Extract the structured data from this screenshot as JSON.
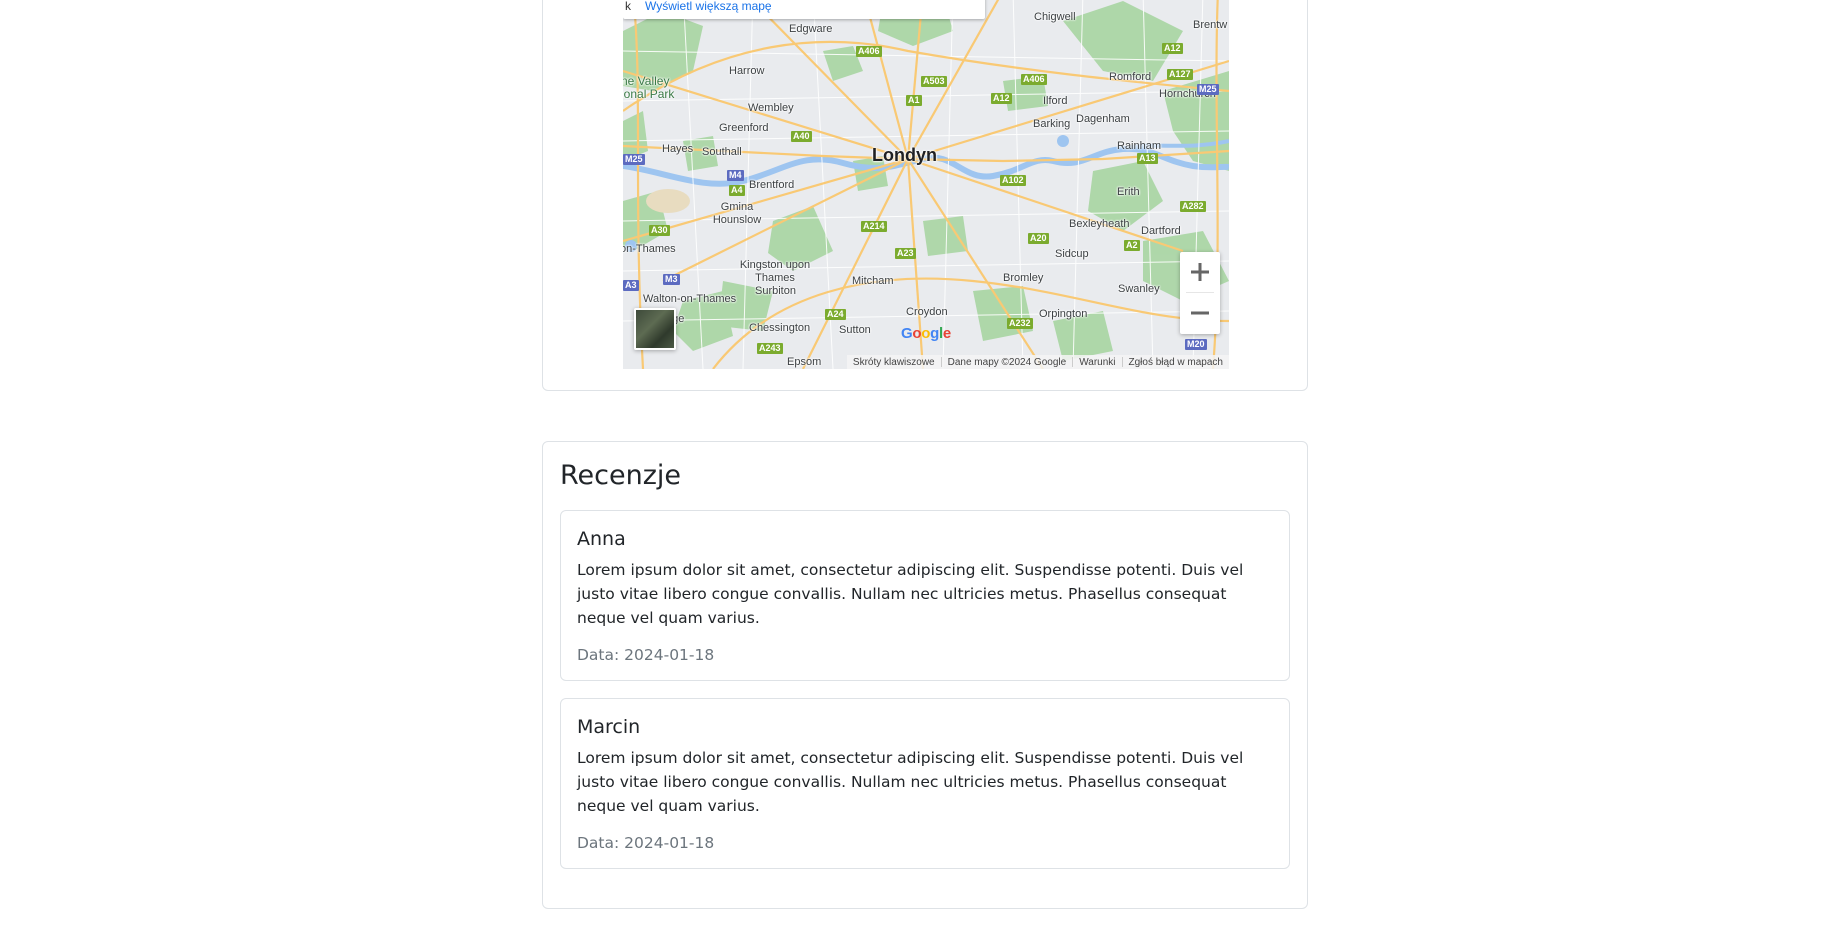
{
  "map": {
    "larger_map_link": "Wyświetl większą mapę",
    "city": "Londyn",
    "places": [
      "Chigwell",
      "Edgware",
      "Harrow",
      "Wembley",
      "Greenford",
      "Hayes",
      "Southall",
      "Brentford",
      "Gmina Hounslow",
      "Kingston upon Thames",
      "Surbiton",
      "Walton-on-Thames",
      "Chessington",
      "Sutton",
      "Mitcham",
      "Croydon",
      "Bromley",
      "Orpington",
      "Sidcup",
      "Bexleyheath",
      "Dartford",
      "Swanley",
      "Erith",
      "Rainham",
      "Dagenham",
      "Barking",
      "Ilford",
      "Romford",
      "Hornchurch",
      "Brentw",
      "on-Thames",
      "dge",
      "Epsom"
    ],
    "park_label": "ne Valley\nional Park",
    "roads": [
      "A406",
      "A503",
      "A1",
      "A12",
      "A406",
      "A12",
      "A127",
      "M25",
      "A40",
      "M25",
      "M4",
      "A4",
      "A102",
      "A13",
      "A282",
      "A30",
      "A214",
      "A23",
      "A20",
      "A2",
      "M3",
      "A3",
      "A24",
      "A232",
      "A243",
      "M20"
    ],
    "zoom_in_label": "+",
    "zoom_out_label": "−",
    "logo_text": "Google",
    "attribution": {
      "shortcuts": "Skróty klawiszowe",
      "data": "Dane mapy ©2024 Google",
      "terms": "Warunki",
      "report": "Zgłoś błąd w mapach"
    },
    "colors": {
      "water": "#9ec5f0",
      "park": "#a8d5a2",
      "major_road": "#f9c974",
      "road_badge": "#7bab2e",
      "motorway_badge": "#5c6bc0",
      "link": "#1a73e8"
    }
  },
  "reviews": {
    "title": "Recenzje",
    "items": [
      {
        "author": "Anna",
        "text": "Lorem ipsum dolor sit amet, consectetur adipiscing elit. Suspendisse potenti. Duis vel justo vitae libero congue convallis. Nullam nec ultricies metus. Phasellus consequat neque vel quam varius.",
        "date": "Data: 2024-01-18"
      },
      {
        "author": "Marcin",
        "text": "Lorem ipsum dolor sit amet, consectetur adipiscing elit. Suspendisse potenti. Duis vel justo vitae libero congue convallis. Nullam nec ultricies metus. Phasellus consequat neque vel quam varius.",
        "date": "Data: 2024-01-18"
      }
    ]
  }
}
